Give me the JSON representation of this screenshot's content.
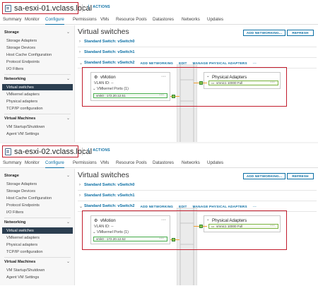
{
  "panels": [
    {
      "host": "sa-esxi-01.vclass.local",
      "vmk_ip": "vmk0 : 172.20.12.51"
    },
    {
      "host": "sa-esxi-02.vclass.local",
      "vmk_ip": "vmk0 : 172.20.12.52"
    }
  ],
  "actions_label": "ACTIONS",
  "tabs": [
    "Summary",
    "Monitor",
    "Configure",
    "Permissions",
    "VMs",
    "Resource Pools",
    "Datastores",
    "Networks",
    "Updates"
  ],
  "sidebar": {
    "storage": {
      "label": "Storage",
      "items": [
        "Storage Adapters",
        "Storage Devices",
        "Host Cache Configuration",
        "Protocol Endpoints",
        "I/O Filters"
      ]
    },
    "networking": {
      "label": "Networking",
      "items": [
        "Virtual switches",
        "VMkernel adapters",
        "Physical adapters",
        "TCP/IP configuration"
      ]
    },
    "vms": {
      "label": "Virtual Machines",
      "items": [
        "VM Startup/Shutdown",
        "Agent VM Settings"
      ]
    }
  },
  "main": {
    "title": "Virtual switches",
    "add_networking": "ADD NETWORKING...",
    "refresh": "REFRESH",
    "switches": [
      "Standard Switch: vSwitch0",
      "Standard Switch: vSwitch1",
      "Standard Switch: vSwitch2"
    ],
    "switch_actions": [
      "ADD NETWORKING",
      "EDIT",
      "MANAGE PHYSICAL ADAPTERS",
      "···"
    ],
    "portgroup": {
      "name": "vMotion",
      "vlan": "VLAN ID: --",
      "vmk_ports": "VMkernel Ports (1)"
    },
    "physical": {
      "title": "Physical Adapters",
      "nic": "vmnic1 10000 Full"
    }
  },
  "colors": {
    "accent": "#0b6fa4",
    "highlight": "#c21d2d",
    "selected_bg": "#2b3e50",
    "cable": "#f0a030"
  }
}
